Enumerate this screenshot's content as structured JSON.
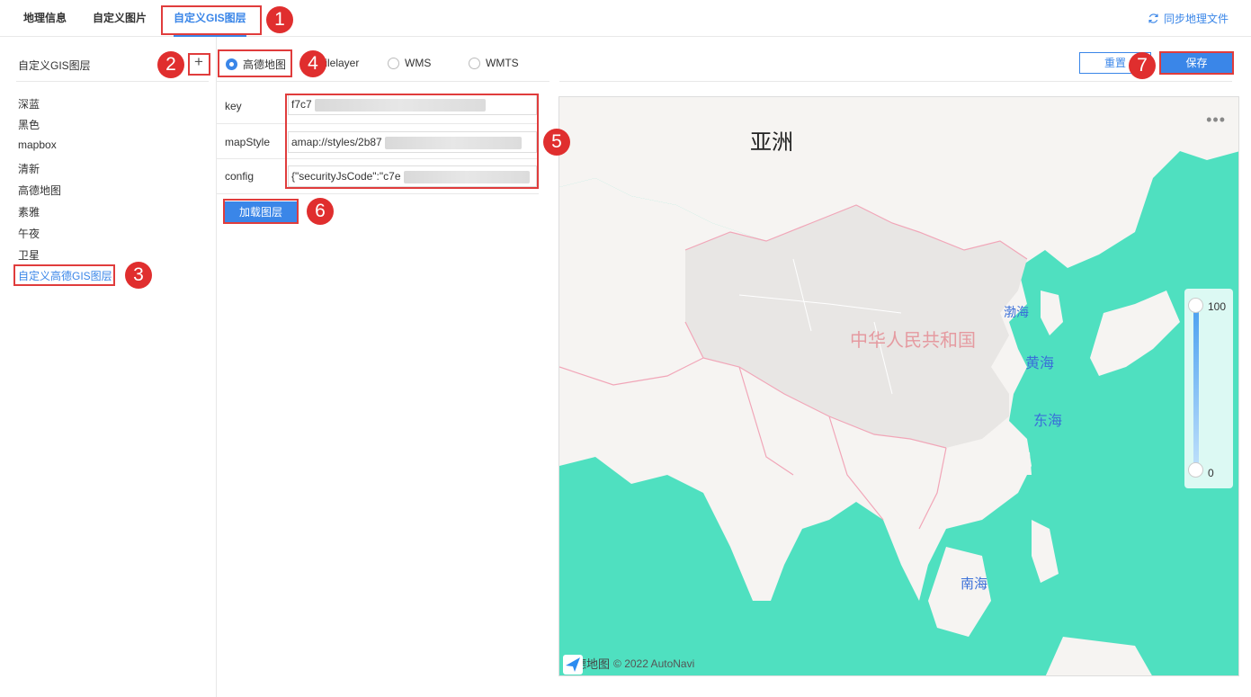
{
  "tabs": [
    {
      "label": "地理信息"
    },
    {
      "label": "自定义图片"
    },
    {
      "label": "自定义GIS图层"
    }
  ],
  "sync_label": "同步地理文件",
  "left_panel": {
    "title": "自定义GIS图层",
    "add_symbol": "+",
    "items": [
      "深蓝",
      "黑色",
      "mapbox",
      "清新",
      "高德地图",
      "素雅",
      "午夜",
      "卫星",
      "自定义高德GIS图层"
    ]
  },
  "layer_type": {
    "options": [
      "高德地图",
      "tilelayer",
      "WMS",
      "WMTS"
    ],
    "selected": "高德地图"
  },
  "form": {
    "key_label": "key",
    "key_value": "f7c7",
    "mapstyle_label": "mapStyle",
    "mapstyle_value": "amap://styles/2b87",
    "config_label": "config",
    "config_value": "{\"securityJsCode\":\"c7e",
    "load_button": "加载图层"
  },
  "actions": {
    "reset": "重置",
    "save": "保存"
  },
  "map": {
    "labels": {
      "asia": "亚洲",
      "china": "中华人民共和国",
      "bohai": "渤海",
      "yellow_sea": "黄海",
      "east_sea": "东海",
      "south_sea": "南海"
    },
    "slider_max": "100",
    "slider_min": "0",
    "more_glyph": "•••",
    "provider_logo": "高德地图",
    "copyright": "© 2022 AutoNavi",
    "colors": {
      "sea": "#4fe0c0",
      "land": "#f6f4f2",
      "china": "#e8e6e4",
      "border": "#f1a6b8"
    }
  },
  "callouts": [
    "1",
    "2",
    "3",
    "4",
    "5",
    "6",
    "7"
  ]
}
